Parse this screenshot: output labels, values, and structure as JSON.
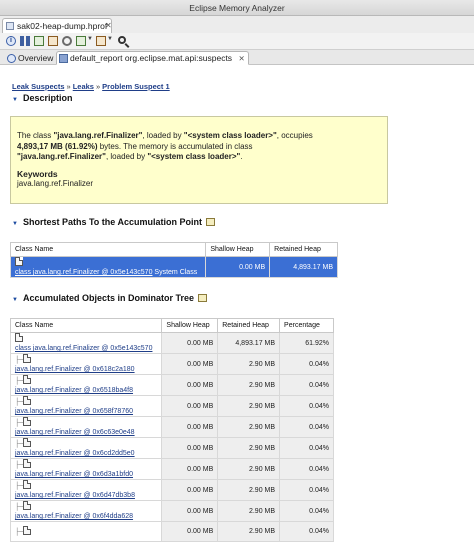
{
  "window": {
    "title": "Eclipse Memory Analyzer"
  },
  "file_tab": {
    "label": "sak02-heap-dump.hprof",
    "close": "✕"
  },
  "toolbar": {
    "icons": [
      "info-icon",
      "histogram-icon",
      "dominator-tree-icon",
      "query-icon",
      "gear-icon",
      "dropdown-icon",
      "dropdown-icon",
      "search-icon"
    ]
  },
  "view_tabs": [
    {
      "label": "Overview",
      "icon": "info-icon"
    },
    {
      "label": "default_report  org.eclipse.mat.api:suspects",
      "icon": "report-icon",
      "close": "✕"
    }
  ],
  "breadcrumb": [
    "Leak Suspects",
    "Leaks",
    "Problem Suspect 1"
  ],
  "description": {
    "title": "Description",
    "p1_a": "The class ",
    "p1_class": "\"java.lang.ref.Finalizer\"",
    "p1_b": ", loaded by ",
    "p1_loader": "\"<system class loader>\"",
    "p1_c": ", occupies",
    "p1_size": "4,893,17 MB (61.92%)",
    "p1_d": " bytes. The memory is accumulated in class",
    "p1_class2": "\"java.lang.ref.Finalizer\"",
    "p1_e": ", loaded by ",
    "p1_loader2": "\"<system class loader>\"",
    "p1_f": ".",
    "keywords_title": "Keywords",
    "keywords": "java.lang.ref.Finalizer"
  },
  "shortest_paths": {
    "title": "Shortest Paths To the Accumulation Point",
    "columns": [
      "Class Name",
      "Shallow Heap",
      "Retained Heap"
    ],
    "row": {
      "link": "class java.lang.ref.Finalizer @ 0x5e143c570",
      "suffix": " System Class",
      "shallow": "0.00 MB",
      "retained": "4,893.17 MB"
    }
  },
  "dominator": {
    "title": "Accumulated Objects in Dominator Tree",
    "columns": [
      "Class Name",
      "Shallow Heap",
      "Retained Heap",
      "Percentage"
    ],
    "rows": [
      {
        "name": "class java.lang.ref.Finalizer @ 0x5e143c570",
        "shallow": "0.00 MB",
        "retained": "4,893.17 MB",
        "pct": "61.92%"
      },
      {
        "name": "java.lang.ref.Finalizer @ 0x618c2a180",
        "shallow": "0.00 MB",
        "retained": "2.90 MB",
        "pct": "0.04%"
      },
      {
        "name": "java.lang.ref.Finalizer @ 0x6518ba4f8",
        "shallow": "0.00 MB",
        "retained": "2.90 MB",
        "pct": "0.04%"
      },
      {
        "name": "java.lang.ref.Finalizer @ 0x658f78760",
        "shallow": "0.00 MB",
        "retained": "2.90 MB",
        "pct": "0.04%"
      },
      {
        "name": "java.lang.ref.Finalizer @ 0x6c63e0e48",
        "shallow": "0.00 MB",
        "retained": "2.90 MB",
        "pct": "0.04%"
      },
      {
        "name": "java.lang.ref.Finalizer @ 0x6cd2dd5e0",
        "shallow": "0.00 MB",
        "retained": "2.90 MB",
        "pct": "0.04%"
      },
      {
        "name": "java.lang.ref.Finalizer @ 0x6d3a1bfd0",
        "shallow": "0.00 MB",
        "retained": "2.90 MB",
        "pct": "0.04%"
      },
      {
        "name": "java.lang.ref.Finalizer @ 0x6d47db3b8",
        "shallow": "0.00 MB",
        "retained": "2.90 MB",
        "pct": "0.04%"
      },
      {
        "name": "java.lang.ref.Finalizer @ 0x6f4dda628",
        "shallow": "0.00 MB",
        "retained": "2.90 MB",
        "pct": "0.04%"
      },
      {
        "name": "",
        "shallow": "0.00 MB",
        "retained": "2.90 MB",
        "pct": "0.04%"
      }
    ]
  }
}
